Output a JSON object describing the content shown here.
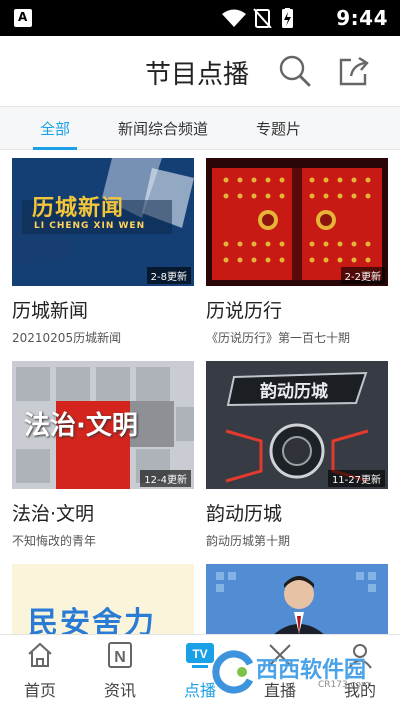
{
  "status_bar": {
    "time": "9:44",
    "app_badge": "A"
  },
  "header": {
    "title": "节目点播"
  },
  "tabs": [
    {
      "label": "全部",
      "active": true
    },
    {
      "label": "新闻综合频道",
      "active": false
    },
    {
      "label": "专题片",
      "active": false
    }
  ],
  "cards": [
    {
      "title": "历城新闻",
      "subtitle": "20210205历城新闻",
      "badge": "2-8更新",
      "thumb_text": "历城新闻",
      "thumb_sub": "LI CHENG XIN WEN"
    },
    {
      "title": "历说历行",
      "subtitle": "《历说历行》第一百七十期",
      "badge": "2-2更新"
    },
    {
      "title": "法治·文明",
      "subtitle": "不知悔改的青年",
      "badge": "12-4更新",
      "thumb_text": "法治·文明"
    },
    {
      "title": "韵动历城",
      "subtitle": "韵动历城第十期",
      "badge": "11-27更新",
      "thumb_text": "韵动历城"
    },
    {
      "thumb_text": "民安舍力"
    },
    {}
  ],
  "bottom_nav": [
    {
      "label": "首页",
      "icon": "home-icon",
      "active": false
    },
    {
      "label": "资讯",
      "icon": "news-icon",
      "active": false
    },
    {
      "label": "点播",
      "icon": "tv-icon",
      "active": true,
      "icon_text": "TV"
    },
    {
      "label": "直播",
      "icon": "live-icon",
      "active": false
    },
    {
      "label": "我的",
      "icon": "profile-icon",
      "active": false
    }
  ],
  "watermark": {
    "text": "西西软件园",
    "url": "CR173.com"
  },
  "colors": {
    "accent": "#1aa0e6",
    "status_bar": "#000000"
  }
}
